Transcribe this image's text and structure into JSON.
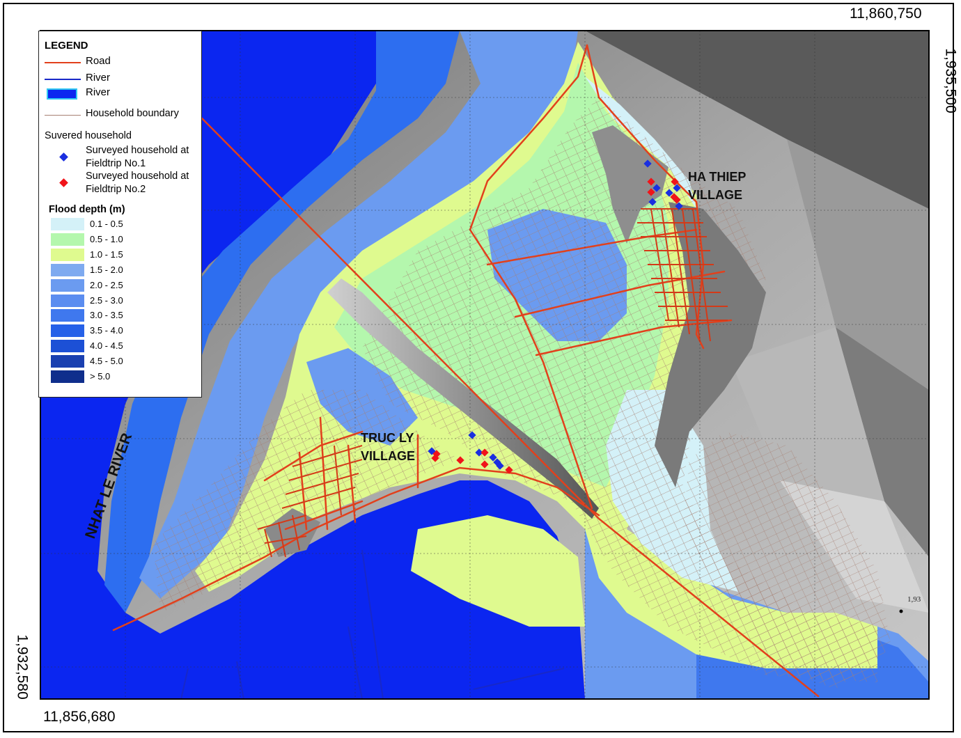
{
  "coordinates": {
    "top_right": "11,860,750",
    "bottom_left": "11,856,680",
    "right_vertical": "1,935,500",
    "left_vertical": "1,932,580",
    "small_label": "1,93"
  },
  "map_labels": {
    "river": "NHAT LE RIVER",
    "ha_thiep_line1": "HA THIEP",
    "ha_thiep_line2": "VILLAGE",
    "truc_ly_line1": "TRUC LY",
    "truc_ly_line2": "VILLAGE"
  },
  "legend": {
    "title": "LEGEND",
    "road": "Road",
    "river_line": "River",
    "river_poly": "River",
    "household_boundary": "Household boundary",
    "survey_title": "Suvered household",
    "fieldtrip1_line1": "Surveyed household at",
    "fieldtrip1_line2": "Fieldtrip No.1",
    "fieldtrip2_line1": "Surveyed household at",
    "fieldtrip2_line2": "Fieldtrip No.2",
    "flood_title": "Flood depth (m)",
    "flood_classes": [
      {
        "label": "0.1 - 0.5",
        "color": "#d4f1f8"
      },
      {
        "label": "0.5 - 1.0",
        "color": "#b4f7ad"
      },
      {
        "label": "1.0 - 1.5",
        "color": "#dffa8f"
      },
      {
        "label": "1.5 - 2.0",
        "color": "#7eaaf0"
      },
      {
        "label": "2.0 - 2.5",
        "color": "#6b9bf0"
      },
      {
        "label": "2.5 - 3.0",
        "color": "#5b8df0"
      },
      {
        "label": "3.0 - 3.5",
        "color": "#3f78ee"
      },
      {
        "label": "3.5 - 4.0",
        "color": "#2661e8"
      },
      {
        "label": "4.0 - 4.5",
        "color": "#1c50d6"
      },
      {
        "label": "4.5 - 5.0",
        "color": "#1a40b0"
      },
      {
        "label": "> 5.0",
        "color": "#0f2e8c"
      }
    ]
  },
  "colors": {
    "road": "#e2401c",
    "river_line": "#1828c8",
    "river_fill": "#0b26f0",
    "household_boundary": "#a67f72",
    "fieldtrip1": "#1a2fe0",
    "fieldtrip2": "#f0141a",
    "terrain": "#8a8a8a"
  }
}
